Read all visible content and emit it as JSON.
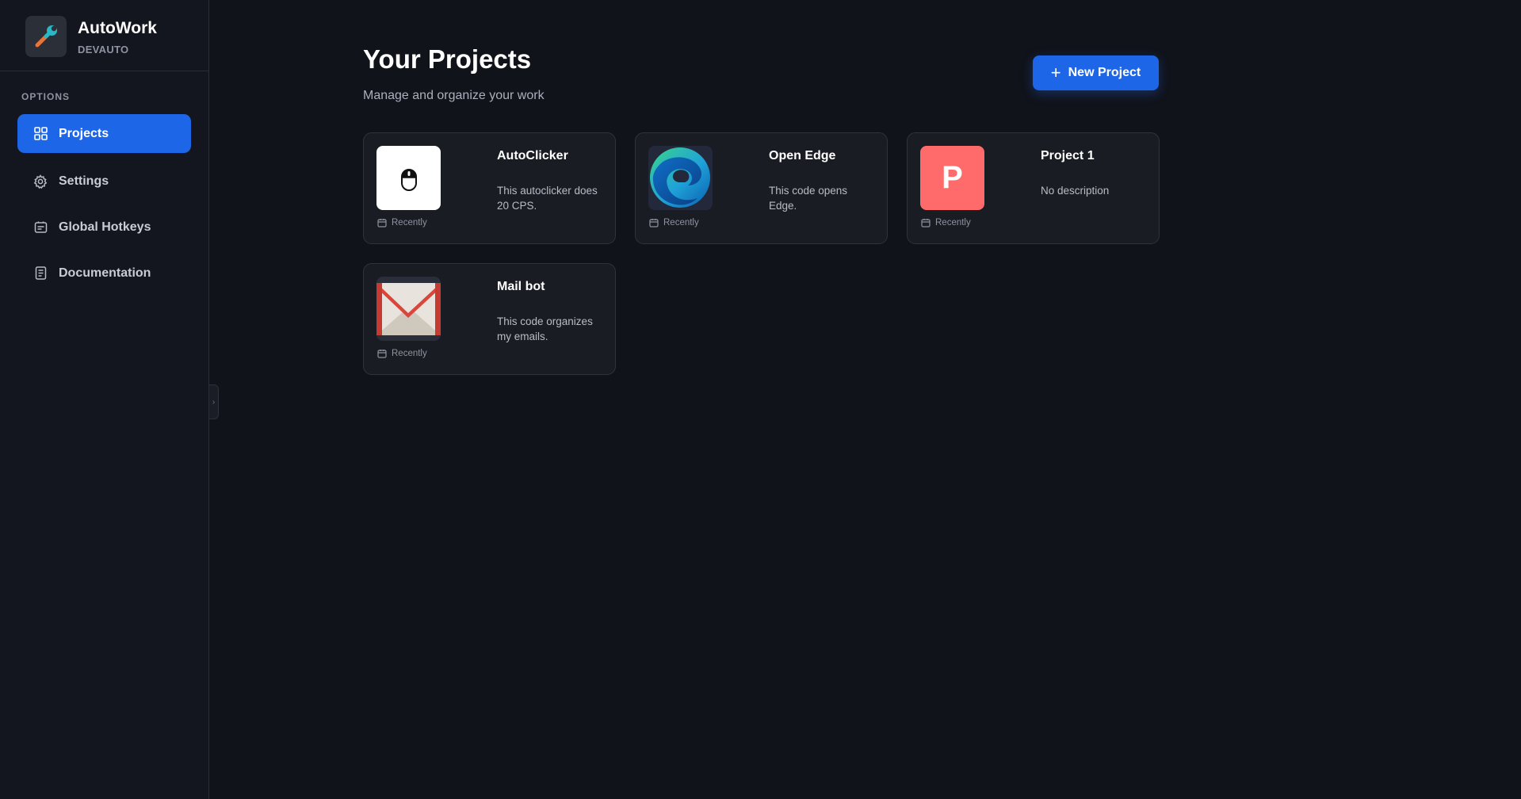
{
  "brand": {
    "name": "AutoWork",
    "subtitle": "DEVAUTO"
  },
  "sidebar": {
    "section_label": "OPTIONS",
    "items": [
      {
        "label": "Projects",
        "icon": "grid-icon",
        "active": true
      },
      {
        "label": "Settings",
        "icon": "gear-icon",
        "active": false
      },
      {
        "label": "Global Hotkeys",
        "icon": "keyboard-icon",
        "active": false
      },
      {
        "label": "Documentation",
        "icon": "document-icon",
        "active": false
      }
    ]
  },
  "main": {
    "title": "Your Projects",
    "subtitle": "Manage and organize your work",
    "new_button_label": "New Project"
  },
  "projects": [
    {
      "title": "AutoClicker",
      "description": "This autoclicker does 20 CPS.",
      "date": "Recently",
      "icon": "mouse-icon"
    },
    {
      "title": "Open Edge",
      "description": "This code opens Edge.",
      "date": "Recently",
      "icon": "edge-logo-icon"
    },
    {
      "title": "Project 1",
      "description": "No description",
      "date": "Recently",
      "icon": "letter-p-icon",
      "thumb_letter": "P",
      "thumb_color": "#ff6b6b"
    },
    {
      "title": "Mail bot",
      "description": "This code organizes my emails.",
      "date": "Recently",
      "icon": "gmail-logo-icon"
    }
  ],
  "colors": {
    "accent": "#1e66e8",
    "background": "#11131b",
    "sidebar": "#13161e",
    "card": "#1a1c23"
  }
}
